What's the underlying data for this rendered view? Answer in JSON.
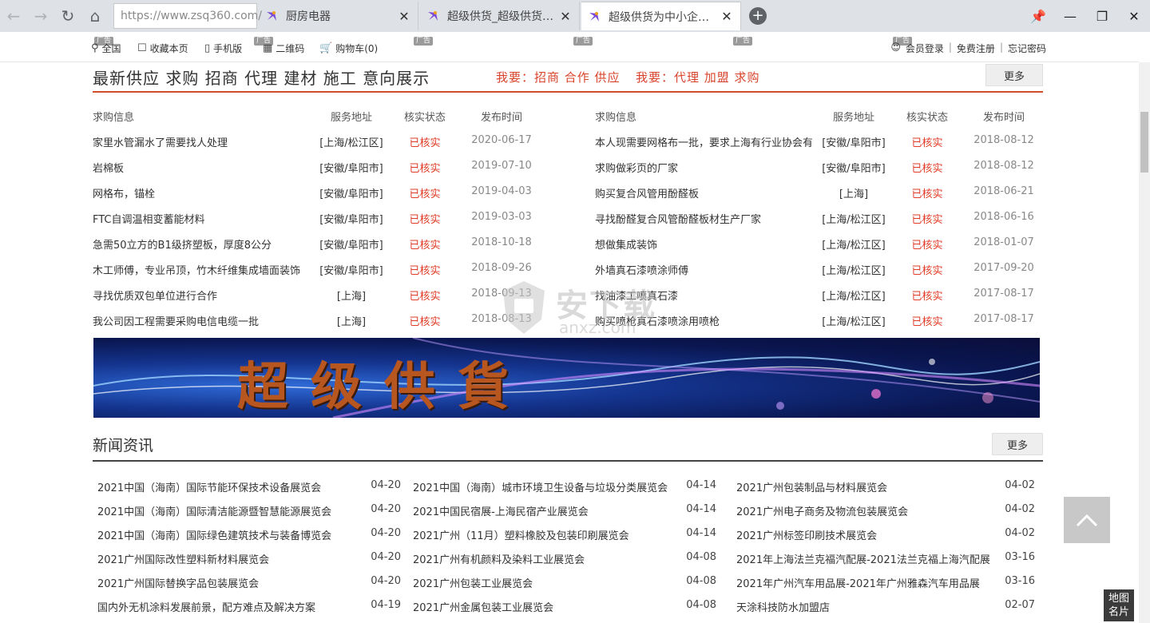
{
  "browser": {
    "address": "https://www.zsq360.com/",
    "tabs": [
      {
        "title": "厨房电器",
        "active": false
      },
      {
        "title": "超级供货_超级供货平台...",
        "active": false
      },
      {
        "title": "超级供货为中小企业提供...",
        "active": true
      }
    ]
  },
  "topbar": {
    "ad_label": "广告",
    "items": [
      "全国",
      "收藏本页",
      "手机版",
      "二维码",
      "购物车(0)"
    ],
    "login": "会员登录",
    "register": "免费注册",
    "forgot": "忘记密码"
  },
  "supply": {
    "title": "最新供应 求购 招商 代理 建材 施工 意向展示",
    "want1": "我要：招商 合作 供应",
    "want2": "我要：代理 加盟 求购",
    "more": "更多",
    "headers": [
      "求购信息",
      "服务地址",
      "核实状态",
      "发布时间"
    ],
    "left": [
      [
        "家里水管漏水了需要找人处理",
        "[上海/松江区]",
        "已核实",
        "2020-06-17"
      ],
      [
        "岩棉板",
        "[安徽/阜阳市]",
        "已核实",
        "2019-07-10"
      ],
      [
        "网格布，锚栓",
        "[安徽/阜阳市]",
        "已核实",
        "2019-04-03"
      ],
      [
        "FTC自调温相变蓄能材料",
        "[安徽/阜阳市]",
        "已核实",
        "2019-03-03"
      ],
      [
        "急需50立方的B1级挤塑板，厚度8公分",
        "[安徽/阜阳市]",
        "已核实",
        "2018-10-18"
      ],
      [
        "木工师傅，专业吊顶，竹木纤维集成墙面装饰",
        "[安徽/阜阳市]",
        "已核实",
        "2018-09-26"
      ],
      [
        "寻找优质双包单位进行合作",
        "[上海]",
        "已核实",
        "2018-09-13"
      ],
      [
        "我公司因工程需要采购电信电缆一批",
        "[上海]",
        "已核实",
        "2018-08-13"
      ]
    ],
    "right": [
      [
        "本人现需要网格布一批，要求上海有行业协会有",
        "[安徽/阜阳市]",
        "已核实",
        "2018-08-12"
      ],
      [
        "求购做彩页的厂家",
        "[安徽/阜阳市]",
        "已核实",
        "2018-08-12"
      ],
      [
        "购买复合风管用酚醛板",
        "[上海]",
        "已核实",
        "2018-06-21"
      ],
      [
        "寻找酚醛复合风管酚醛板材生产厂家",
        "[上海/松江区]",
        "已核实",
        "2018-06-16"
      ],
      [
        "想做集成装饰",
        "[上海/松江区]",
        "已核实",
        "2018-01-07"
      ],
      [
        "外墙真石漆喷涂师傅",
        "[上海/松江区]",
        "已核实",
        "2017-09-20"
      ],
      [
        "找油漆工喷真石漆",
        "[上海/松江区]",
        "已核实",
        "2017-08-17"
      ],
      [
        "购买喷枪真石漆喷涂用喷枪",
        "[上海/松江区]",
        "已核实",
        "2017-08-17"
      ]
    ]
  },
  "banner": {
    "text": "超级供貨"
  },
  "news": {
    "title": "新闻资讯",
    "more": "更多",
    "col1": [
      [
        "2021中国（海南）国际节能环保技术设备展览会",
        "04-20"
      ],
      [
        "2021中国（海南）国际清洁能源暨智慧能源展览会",
        "04-20"
      ],
      [
        "2021中国（海南）国际绿色建筑技术与装备博览会",
        "04-20"
      ],
      [
        "2021广州国际改性塑料新材料展览会",
        "04-20"
      ],
      [
        "2021广州国际替换字品包装展览会",
        "04-20"
      ],
      [
        "国内外无机涂料发展前景，配方难点及解决方案",
        "04-19"
      ]
    ],
    "col2": [
      [
        "2021中国（海南）城市环境卫生设备与垃圾分类展览会",
        "04-14"
      ],
      [
        "2021中国民宿展-上海民宿产业展览会",
        "04-14"
      ],
      [
        "2021广州（11月）塑料橡胶及包装印刷展览会",
        "04-14"
      ],
      [
        "2021广州有机颜料及染料工业展览会",
        "04-08"
      ],
      [
        "2021广州包装工业展览会",
        "04-08"
      ],
      [
        "2021广州金属包装工业展览会",
        "04-08"
      ]
    ],
    "col3": [
      [
        "2021广州包装制品与材料展览会",
        "04-02"
      ],
      [
        "2021广州电子商务及物流包装展览会",
        "04-02"
      ],
      [
        "2021广州标签印刷技术展览会",
        "04-02"
      ],
      [
        "2021年上海法兰克福汽配展-2021法兰克福上海汽配展",
        "03-16"
      ],
      [
        "2021年广州汽车用品展-2021年广州雅森汽车用品展",
        "03-16"
      ],
      [
        "天涂科技防水加盟店",
        "02-07"
      ]
    ]
  },
  "float": {
    "map_card": "地图名片"
  },
  "watermark": {
    "main": "安下载",
    "sub": "anxz.com"
  }
}
